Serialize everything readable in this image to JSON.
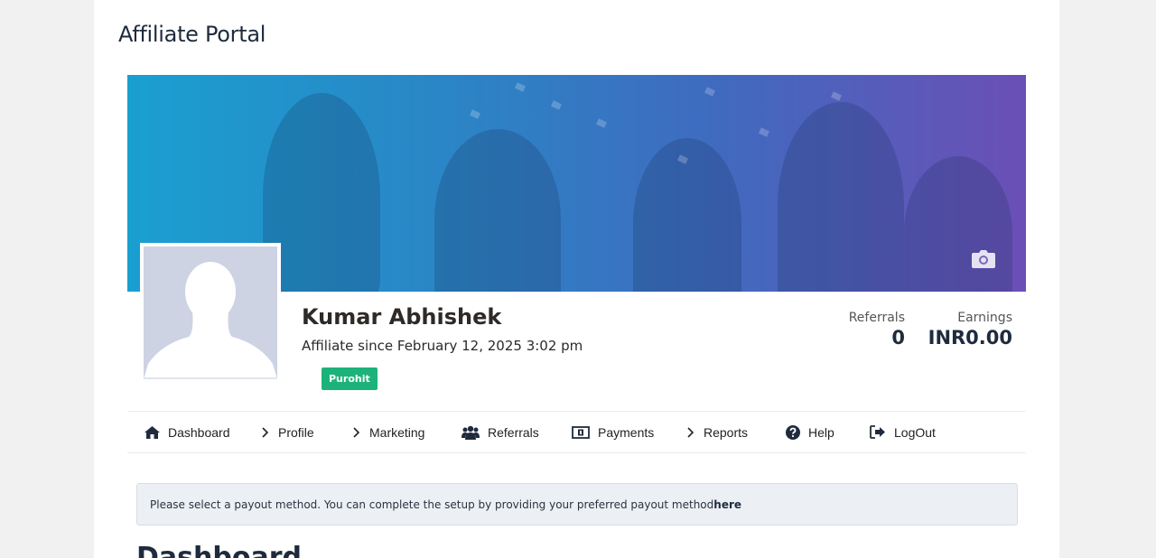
{
  "portal": {
    "title": "Affiliate Portal"
  },
  "profile": {
    "name": "Kumar Abhishek",
    "since": "Affiliate since February 12, 2025 3:02 pm",
    "badge": "Purohit",
    "avatar_icon": "user-silhouette-icon",
    "cover_icon": "camera-icon"
  },
  "stats": {
    "referrals_label": "Referrals",
    "referrals_value": "0",
    "earnings_label": "Earnings",
    "earnings_value": "INR0.00"
  },
  "nav": [
    {
      "label": "Dashboard",
      "icon": "home-icon"
    },
    {
      "label": "Profile",
      "icon": "chevron-right-icon"
    },
    {
      "label": "Marketing",
      "icon": "chevron-right-icon"
    },
    {
      "label": "Referrals",
      "icon": "users-icon"
    },
    {
      "label": "Payments",
      "icon": "money-icon"
    },
    {
      "label": "Reports",
      "icon": "chevron-right-icon"
    },
    {
      "label": "Help",
      "icon": "question-circle-icon"
    },
    {
      "label": "LogOut",
      "icon": "sign-out-icon"
    }
  ],
  "alert": {
    "text": "Please select a payout method. You can complete the setup by providing your preferred payout method",
    "link": "here"
  },
  "main": {
    "heading": "Dashboard"
  },
  "colors": {
    "badge": "#1cb37a",
    "cover_start": "#1a9fd1",
    "cover_end": "#6b4fb6",
    "alert_bg": "#ecf0f4"
  }
}
